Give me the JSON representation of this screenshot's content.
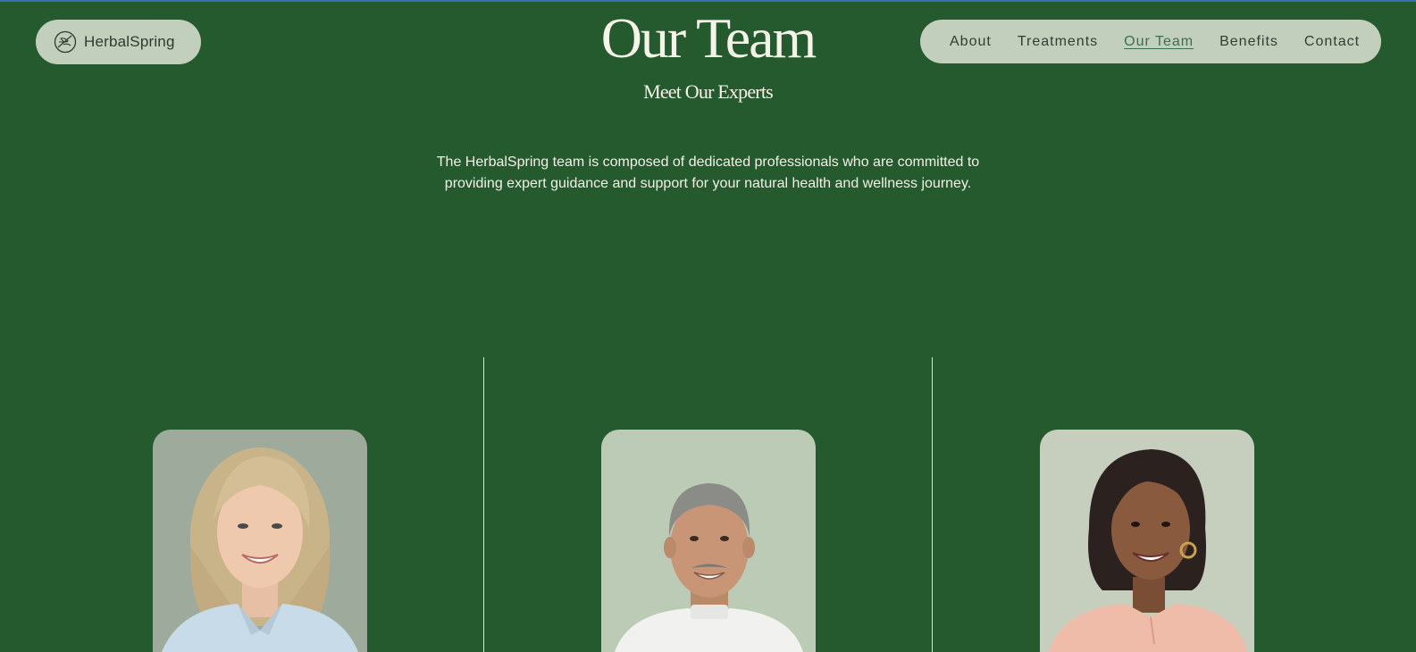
{
  "brand": {
    "name": "HerbalSpring",
    "icon": "herbal-leaf-circle-icon"
  },
  "nav": {
    "items": [
      {
        "label": "About",
        "active": false
      },
      {
        "label": "Treatments",
        "active": false
      },
      {
        "label": "Our Team",
        "active": true
      },
      {
        "label": "Benefits",
        "active": false
      },
      {
        "label": "Contact",
        "active": false
      }
    ]
  },
  "hero": {
    "title": "Our Team",
    "subtitle": "Meet Our Experts",
    "description": "The HerbalSpring team is composed of dedicated professionals who are committed to providing expert guidance and support for your natural health and wellness journey."
  },
  "team": {
    "members": [
      {
        "photo": "team-member-1-photo"
      },
      {
        "photo": "team-member-2-photo"
      },
      {
        "photo": "team-member-3-photo"
      }
    ]
  },
  "colors": {
    "background": "#255a2e",
    "pill": "#c3cfbd",
    "text_light": "#f6f3e8",
    "nav_text": "#2f3f31"
  }
}
